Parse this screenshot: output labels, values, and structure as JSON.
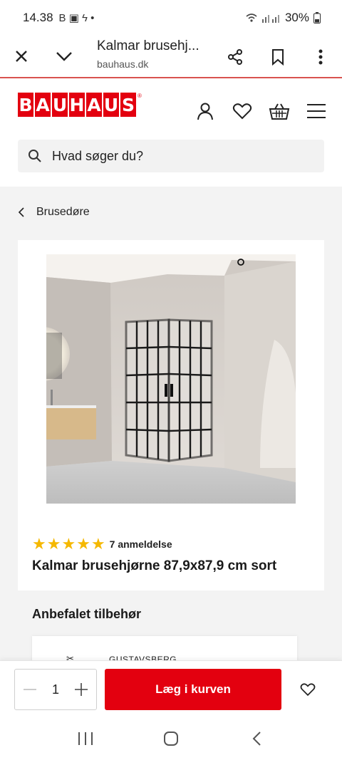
{
  "status_bar": {
    "time": "14.38",
    "icons_left": "B ▣ ϟ •",
    "battery": "30%"
  },
  "browser": {
    "tab_title": "Kalmar brusehj...",
    "url": "bauhaus.dk",
    "icons": [
      "close-icon",
      "chevron-down-icon",
      "share-icon",
      "bookmark-icon",
      "more-vert-icon"
    ]
  },
  "header": {
    "logo_letters": [
      "B",
      "A",
      "U",
      "H",
      "A",
      "U",
      "S"
    ],
    "logo_reg": "®",
    "search_placeholder": "Hvad søger du?"
  },
  "breadcrumb": {
    "label": "Brusedøre"
  },
  "product": {
    "rating": 5,
    "review_count": "7 anmeldelse",
    "title": "Kalmar brusehjørne 87,9x87,9 cm sort"
  },
  "accessories": {
    "title": "Anbefalet tilbehør",
    "first_brand": "GUSTAVSBERG"
  },
  "buy_bar": {
    "quantity": "1",
    "add_label": "Læg i kurven"
  },
  "colors": {
    "brand_red": "#e3000f",
    "star": "#f5b800"
  }
}
